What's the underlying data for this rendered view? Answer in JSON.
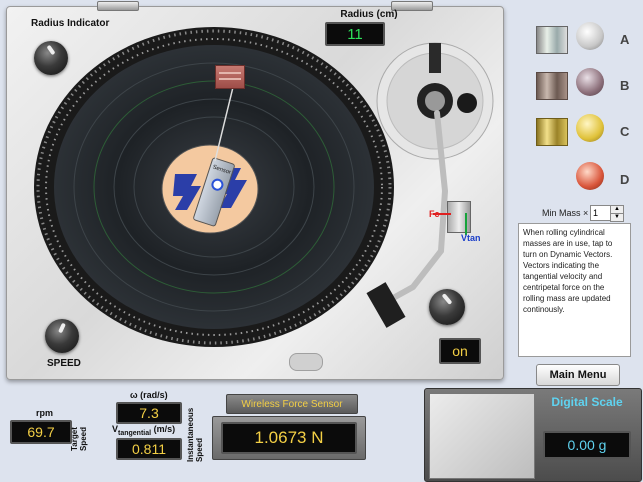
{
  "turntable": {
    "radius_indicator_label": "Radius Indicator",
    "radius_label": "Radius (cm)",
    "radius_value": "11",
    "speed_label": "SPEED",
    "power_value": "on",
    "sensor_label": "Sensor",
    "vector_fc": "Fc",
    "vector_vtan": "Vtan"
  },
  "masses": [
    {
      "letter": "A",
      "color": "#c8c8c8"
    },
    {
      "letter": "B",
      "color": "#8c6f7a"
    },
    {
      "letter": "C",
      "color": "#e0c23a"
    },
    {
      "letter": "D",
      "color": "#d9553a"
    }
  ],
  "min_mass": {
    "label": "Min Mass ×",
    "value": "1"
  },
  "info_text": "When rolling cylindrical masses are in use, tap to turn on Dynamic Vectors. Vectors indicating the tangential velocity and centripetal force on the rolling mass are updated continously.",
  "main_menu_label": "Main Menu",
  "readouts": {
    "rpm_label": "rpm",
    "rpm_value": "69.7",
    "target_speed_label": "Target Speed",
    "omega_label": "ω (rad/s)",
    "omega_value": "7.3",
    "vtan_label_main": "V",
    "vtan_label_sub": "tangential",
    "vtan_label_unit": "(m/s)",
    "vtan_value": "0.811",
    "instantaneous_label": "Instantaneous Speed",
    "force_sensor_label": "Wireless Force Sensor",
    "force_value": "1.0673 N"
  },
  "scale": {
    "title": "Digital Scale",
    "value": "0.00 g"
  }
}
